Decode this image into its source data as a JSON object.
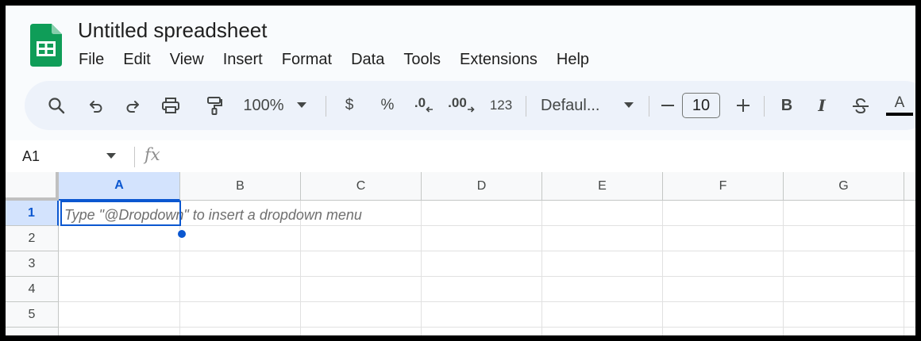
{
  "app": {
    "title": "Untitled spreadsheet",
    "logo_icon": "google-sheets-logo",
    "brand_color": "#0f9d58"
  },
  "menu": [
    "File",
    "Edit",
    "View",
    "Insert",
    "Format",
    "Data",
    "Tools",
    "Extensions",
    "Help"
  ],
  "toolbar": {
    "zoom": "100%",
    "currency": "$",
    "percent": "%",
    "decrease_decimal": ".0",
    "increase_decimal": ".00",
    "number_format": "123",
    "font_family": "Defaul...",
    "font_size": "10",
    "bold": "B",
    "italic": "I",
    "text_color": "A",
    "icons": [
      "search-icon",
      "undo-icon",
      "redo-icon",
      "print-icon",
      "paint-format-icon",
      "chevron-down-icon",
      "minus-icon",
      "plus-icon",
      "strikethrough-icon"
    ]
  },
  "formula_bar": {
    "name_box": "A1",
    "fx": "fx",
    "value": ""
  },
  "sheet": {
    "columns": [
      "A",
      "B",
      "C",
      "D",
      "E",
      "F",
      "G"
    ],
    "rows": [
      "1",
      "2",
      "3",
      "4",
      "5"
    ],
    "selected_cell": "A1",
    "cell_hint": "Type \"@Dropdown\"  to insert a dropdown menu",
    "selection_color": "#0b57d0"
  }
}
